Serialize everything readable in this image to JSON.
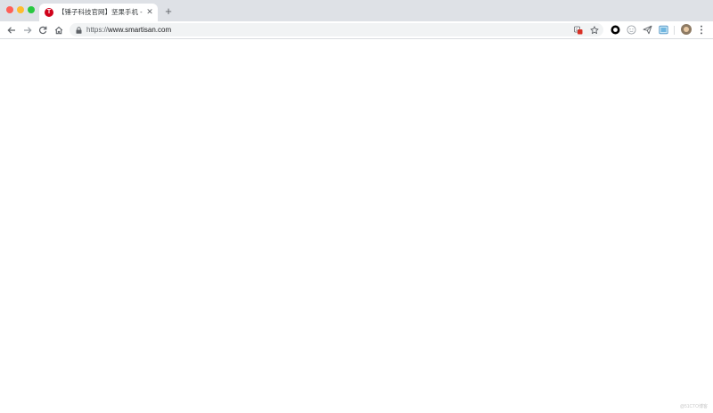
{
  "window": {
    "traffic_lights": {
      "close_color": "#fe5f57",
      "minimize_color": "#febc2e",
      "maximize_color": "#28c840"
    }
  },
  "tabs": [
    {
      "title": "【锤子科技官网】坚果手机 - 坚",
      "favicon": "smartisan-t-logo",
      "favicon_letter": "T",
      "favicon_color": "#d0021b",
      "active": true,
      "close_symbol": "✕"
    }
  ],
  "new_tab_symbol": "+",
  "toolbar": {
    "back_icon": "arrow-left-icon",
    "forward_icon": "arrow-right-icon",
    "reload_icon": "reload-icon",
    "home_icon": "home-icon"
  },
  "omnibox": {
    "scheme": "https://",
    "host": "www.smartisan.com",
    "lock_icon": "lock-icon",
    "translate_icon": "translate-icon",
    "bookmark_icon": "star-icon"
  },
  "extensions": [
    {
      "icon": "black-circle-extension-icon"
    },
    {
      "icon": "smiley-extension-icon"
    },
    {
      "icon": "paper-plane-extension-icon"
    },
    {
      "icon": "screenshot-extension-icon"
    }
  ],
  "profile": {
    "icon": "avatar"
  },
  "menu_icon": "three-dots-vertical-icon",
  "content": {
    "watermark": "@51CTO博客"
  }
}
